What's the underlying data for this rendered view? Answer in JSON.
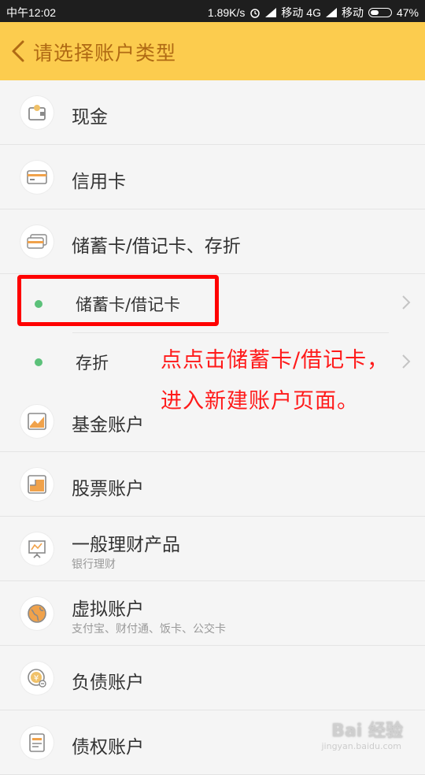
{
  "status_bar": {
    "time": "中午12:02",
    "speed": "1.89K/s",
    "carrier1": "移动 4G",
    "carrier2": "移动",
    "battery": "47%",
    "battery_level": 0.47
  },
  "header": {
    "title": "请选择账户类型",
    "background": "#fccc4e",
    "title_color": "#b06a14"
  },
  "accounts": [
    {
      "label": "现金",
      "icon": "wallet-icon"
    },
    {
      "label": "信用卡",
      "icon": "credit-card-icon"
    },
    {
      "label": "储蓄卡/借记卡、存折",
      "icon": "cards-icon"
    },
    {
      "label": "储蓄卡/借记卡",
      "icon": "green-dot"
    },
    {
      "label": "存折",
      "icon": "green-dot"
    },
    {
      "label": "基金账户",
      "icon": "fund-chart-icon"
    },
    {
      "label": "股票账户",
      "icon": "stock-chart-icon"
    },
    {
      "label": "一般理财产品",
      "sublabel": "银行理财",
      "icon": "presentation-board-icon"
    },
    {
      "label": "虚拟账户",
      "sublabel": "支付宝、财付通、饭卡、公交卡",
      "icon": "globe-icon"
    },
    {
      "label": "负债账户",
      "icon": "coin-icon"
    },
    {
      "label": "债权账户",
      "icon": "document-icon"
    }
  ],
  "annotation": {
    "line1": "点点击储蓄卡/借记卡，",
    "line2": "进入新建账户页面。",
    "color": "#ff1a1a"
  },
  "watermark": {
    "text": "Bai 经验",
    "sub": "jingyan.baidu.com"
  }
}
